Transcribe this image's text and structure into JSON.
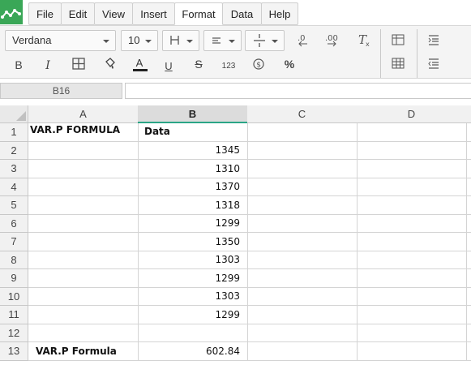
{
  "menubar": {
    "items": [
      "File",
      "Edit",
      "View",
      "Insert",
      "Format",
      "Data",
      "Help"
    ],
    "active": "Format"
  },
  "toolbar": {
    "font_name": "Verdana",
    "font_size": "10",
    "number_format_label": "123"
  },
  "formula_bar": {
    "cell_ref": "B16",
    "formula": ""
  },
  "grid": {
    "columns": [
      "A",
      "B",
      "C",
      "D"
    ],
    "selected_column": "B",
    "rows": [
      {
        "num": "1",
        "a": "VAR.P FORMULA",
        "b": "Data"
      },
      {
        "num": "2",
        "a": "",
        "b": "1345"
      },
      {
        "num": "3",
        "a": "",
        "b": "1310"
      },
      {
        "num": "4",
        "a": "",
        "b": "1370"
      },
      {
        "num": "5",
        "a": "",
        "b": "1318"
      },
      {
        "num": "6",
        "a": "",
        "b": "1299"
      },
      {
        "num": "7",
        "a": "",
        "b": "1350"
      },
      {
        "num": "8",
        "a": "",
        "b": "1303"
      },
      {
        "num": "9",
        "a": "",
        "b": "1299"
      },
      {
        "num": "10",
        "a": "",
        "b": "1303"
      },
      {
        "num": "11",
        "a": "",
        "b": "1299"
      },
      {
        "num": "12",
        "a": "",
        "b": ""
      },
      {
        "num": "13",
        "a": "VAR.P Formula",
        "b": "602.84"
      }
    ]
  },
  "colors": {
    "accent": "#2aa586",
    "logo": "#3aa757",
    "text_color_bar": "#222222"
  }
}
